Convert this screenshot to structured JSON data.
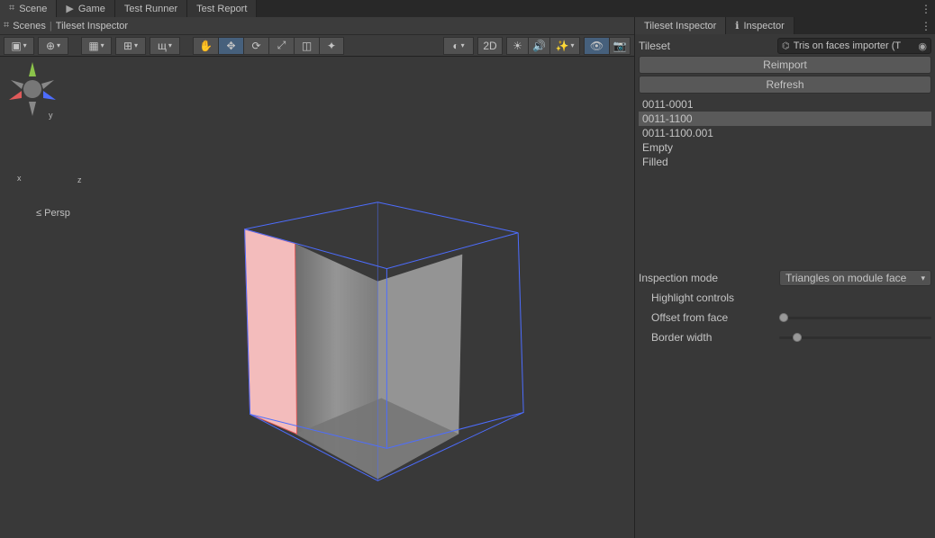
{
  "top_tabs": {
    "scene": "Scene",
    "game": "Game",
    "testrunner": "Test Runner",
    "testreport": "Test Report"
  },
  "breadcrumb": {
    "root": "Scenes",
    "leaf": "Tileset Inspector"
  },
  "scene_toolbar": {
    "mode_2d": "2D"
  },
  "viewport": {
    "axes": {
      "x": "x",
      "y": "y",
      "z": "z"
    },
    "persp_label": "Persp",
    "persp_arrow": "≤"
  },
  "right_tabs": {
    "tileset": "Tileset Inspector",
    "inspector": "Inspector"
  },
  "inspector": {
    "tileset_label": "Tileset",
    "tileset_value": "Tris on faces importer (T",
    "reimport": "Reimport",
    "refresh": "Refresh",
    "items": [
      "0011-0001",
      "0011-1100",
      "0011-1100.001",
      "Empty",
      "Filled"
    ],
    "selected_index": 1,
    "inspection_mode_label": "Inspection mode",
    "inspection_mode_value": "Triangles on module face",
    "highlight_controls": "Highlight controls",
    "offset_from_face": "Offset from face",
    "offset_value_pct": 3,
    "border_width": "Border width",
    "border_value_pct": 12
  },
  "icons": {
    "scene": "⌗",
    "game": "▭",
    "kebab": "⋮",
    "scenes": "⌗",
    "obj": "⌬",
    "picker": "◉",
    "info": "ℹ"
  }
}
